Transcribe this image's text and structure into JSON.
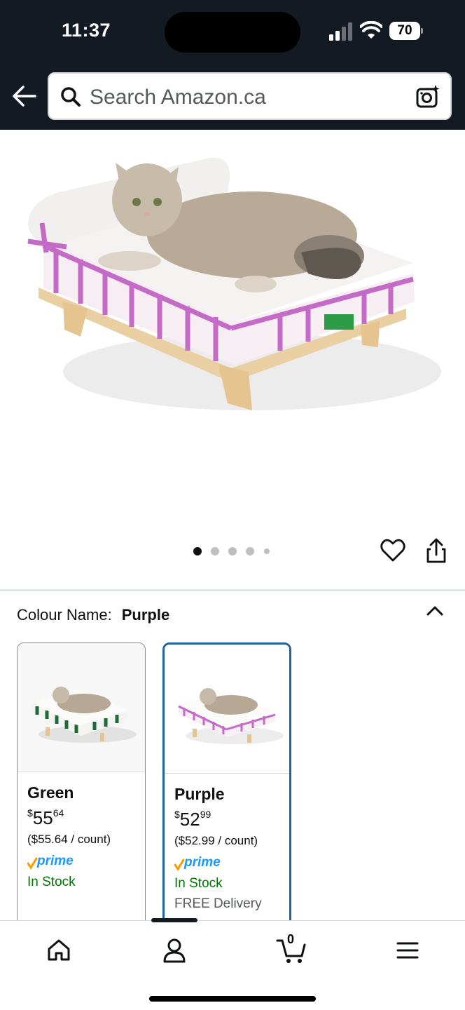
{
  "status_bar": {
    "time": "11:37",
    "battery": "70"
  },
  "search": {
    "placeholder": "Search Amazon.ca"
  },
  "gallery": {
    "dots": 5,
    "active_index": 0
  },
  "colour": {
    "label": "Colour Name:",
    "selected": "Purple"
  },
  "swatches": [
    {
      "name": "Green",
      "price_symbol": "$",
      "price_whole": "55",
      "price_fraction": "64",
      "unit_price": "($55.64 / count)",
      "prime": "prime",
      "stock": "In Stock",
      "delivery": ""
    },
    {
      "name": "Purple",
      "price_symbol": "$",
      "price_whole": "52",
      "price_fraction": "99",
      "unit_price": "($52.99 / count)",
      "prime": "prime",
      "stock": "In Stock",
      "delivery": "FREE Delivery"
    }
  ],
  "cart": {
    "count": "0"
  },
  "colors": {
    "header_bg": "#131a22",
    "selected_border": "#2162a1",
    "stock_green": "#007600",
    "prime_blue": "#1a98ff",
    "prime_check": "#ff9900"
  }
}
